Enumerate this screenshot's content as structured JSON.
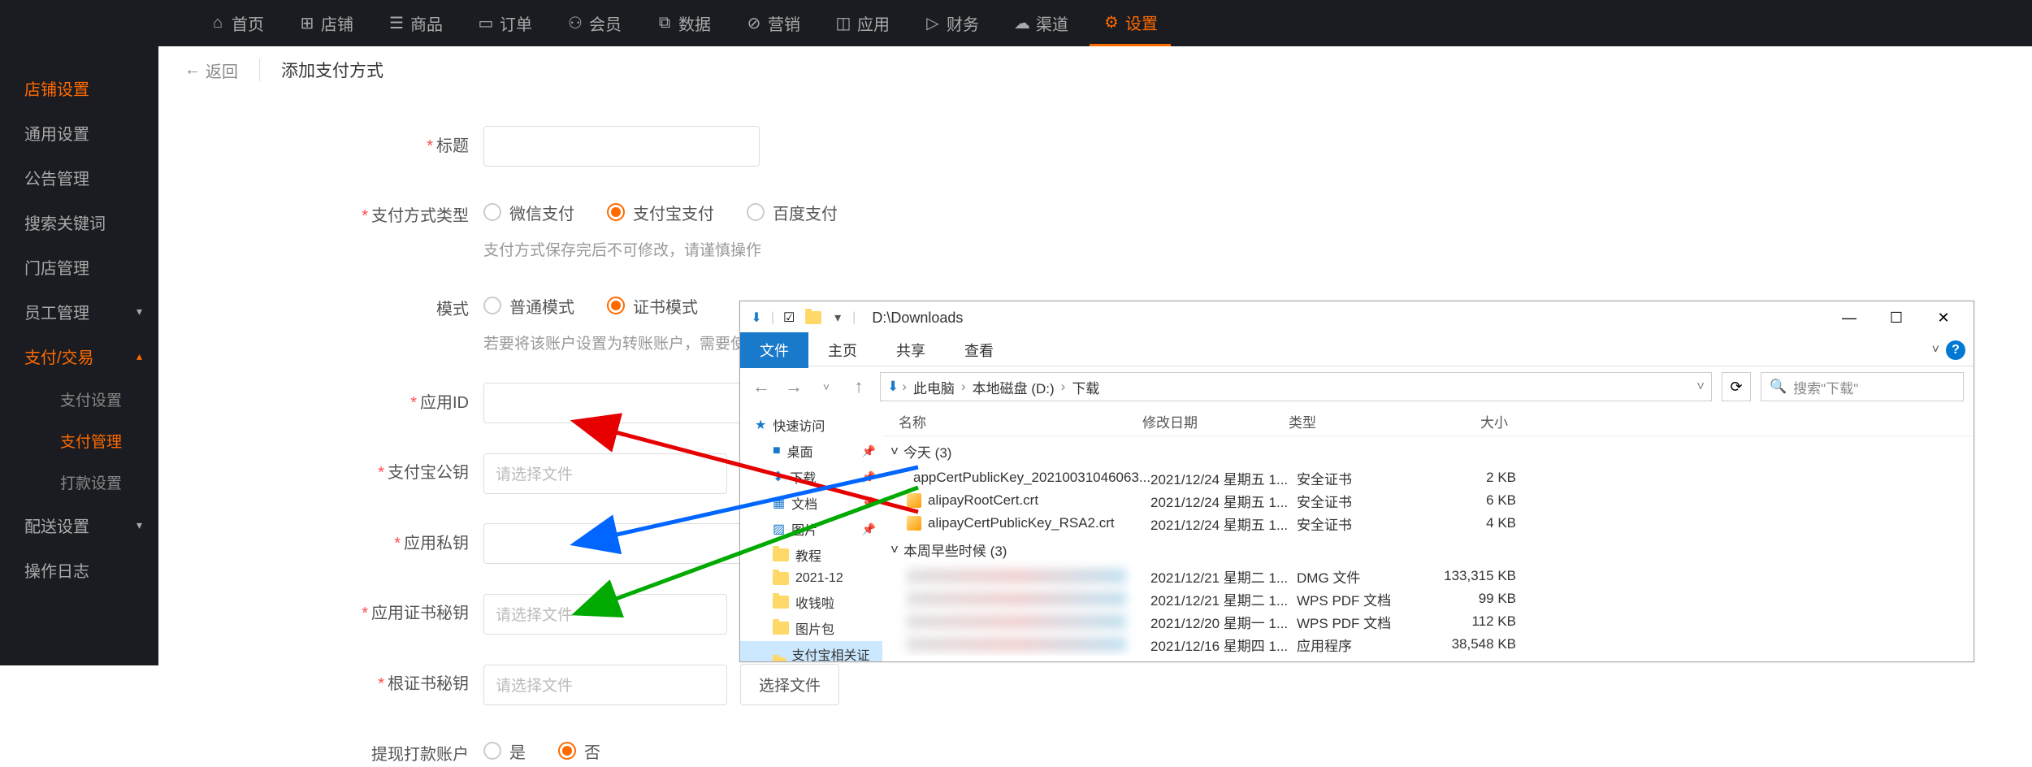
{
  "topnav": [
    {
      "icon": "⌂",
      "label": "首页"
    },
    {
      "icon": "⊞",
      "label": "店铺"
    },
    {
      "icon": "☰",
      "label": "商品"
    },
    {
      "icon": "▭",
      "label": "订单"
    },
    {
      "icon": "⚇",
      "label": "会员"
    },
    {
      "icon": "⧉",
      "label": "数据"
    },
    {
      "icon": "⊘",
      "label": "营销"
    },
    {
      "icon": "◫",
      "label": "应用"
    },
    {
      "icon": "▷",
      "label": "财务"
    },
    {
      "icon": "☁",
      "label": "渠道"
    },
    {
      "icon": "⚙",
      "label": "设置"
    }
  ],
  "sidebar": {
    "items": [
      {
        "label": "店铺设置",
        "active": true
      },
      {
        "label": "通用设置"
      },
      {
        "label": "公告管理"
      },
      {
        "label": "搜索关键词"
      },
      {
        "label": "门店管理"
      },
      {
        "label": "员工管理",
        "expand": "▾"
      },
      {
        "label": "支付/交易",
        "active": true,
        "expand": "▴"
      },
      {
        "label": "配送设置",
        "expand": "▾"
      },
      {
        "label": "操作日志"
      }
    ],
    "sub": [
      {
        "label": "支付设置"
      },
      {
        "label": "支付管理",
        "active": true
      },
      {
        "label": "打款设置"
      }
    ]
  },
  "header": {
    "back": "返回",
    "title": "添加支付方式"
  },
  "form": {
    "title_label": "标题",
    "paytype_label": "支付方式类型",
    "paytype_options": [
      "微信支付",
      "支付宝支付",
      "百度支付"
    ],
    "paytype_hint": "支付方式保存完后不可修改，请谨慎操作",
    "mode_label": "模式",
    "mode_options": [
      "普通模式",
      "证书模式"
    ],
    "mode_hint": "若要将该账户设置为转账账户，需要使用证书模式。",
    "appid_label": "应用ID",
    "alipay_pubkey_label": "支付宝公钥",
    "app_privkey_label": "应用私钥",
    "app_cert_secret_label": "应用证书秘钥",
    "root_cert_secret_label": "根证书秘钥",
    "withdraw_account_label": "提现打款账户",
    "withdraw_options": [
      "是",
      "否"
    ],
    "file_placeholder": "请选择文件",
    "file_btn": "选择文件"
  },
  "explorer": {
    "title_path": "D:\\Downloads",
    "tabs": [
      "文件",
      "主页",
      "共享",
      "查看"
    ],
    "breadcrumb": [
      "此电脑",
      "本地磁盘 (D:)",
      "下载"
    ],
    "search_placeholder": "搜索\"下载\"",
    "tree": {
      "quick": "快速访问",
      "items": [
        "桌面",
        "下载",
        "文档",
        "图片",
        "教程",
        "2021-12",
        "收钱啦",
        "图片包",
        "支付宝相关证书-新"
      ]
    },
    "columns": {
      "name": "名称",
      "date": "修改日期",
      "type": "类型",
      "size": "大小"
    },
    "groups": [
      {
        "title": "今天 (3)",
        "rows": [
          {
            "name": "appCertPublicKey_20210031046063...",
            "date": "2021/12/24 星期五 1...",
            "type": "安全证书",
            "size": "2 KB",
            "icon": "cert"
          },
          {
            "name": "alipayRootCert.crt",
            "date": "2021/12/24 星期五 1...",
            "type": "安全证书",
            "size": "6 KB",
            "icon": "cert"
          },
          {
            "name": "alipayCertPublicKey_RSA2.crt",
            "date": "2021/12/24 星期五 1...",
            "type": "安全证书",
            "size": "4 KB",
            "icon": "cert"
          }
        ]
      },
      {
        "title": "本周早些时候 (3)",
        "rows": [
          {
            "name": "",
            "date": "2021/12/21 星期二 1...",
            "type": "DMG 文件",
            "size": "133,315 KB",
            "blur": true
          },
          {
            "name": "",
            "date": "2021/12/21 星期二 1...",
            "type": "WPS PDF 文档",
            "size": "99 KB",
            "blur": true
          },
          {
            "name": "",
            "date": "2021/12/20 星期一 1...",
            "type": "WPS PDF 文档",
            "size": "112 KB",
            "blur": true
          }
        ]
      },
      {
        "title": "",
        "rows": [
          {
            "name": "",
            "date": "2021/12/16 星期四 1...",
            "type": "应用程序",
            "size": "38,548 KB",
            "blur": true
          }
        ]
      }
    ]
  }
}
